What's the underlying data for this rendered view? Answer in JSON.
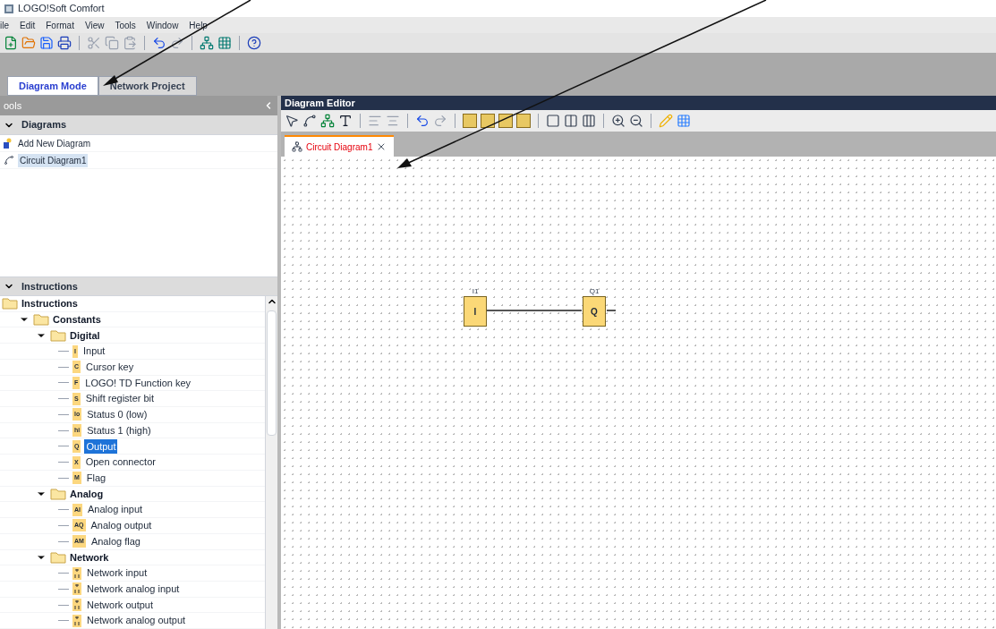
{
  "window": {
    "title": "LOGO!Soft Comfort"
  },
  "menu": [
    "ile",
    "Edit",
    "Format",
    "View",
    "Tools",
    "Window",
    "Help"
  ],
  "mode_tabs": [
    {
      "label": "Diagram Mode",
      "selected": true
    },
    {
      "label": "Network Project",
      "selected": false
    }
  ],
  "tools_panel": {
    "title": "ools",
    "diagrams": {
      "title": "Diagrams",
      "expanded": true,
      "items": [
        {
          "label": "Add New Diagram",
          "kind": "add",
          "selected": false
        },
        {
          "label": "Circuit Diagram1",
          "kind": "diagram",
          "selected": true
        }
      ]
    },
    "instructions": {
      "title": "Instructions",
      "expanded": true,
      "tree": [
        {
          "label": "Instructions",
          "kind": "folder",
          "expanded": true,
          "children": [
            {
              "label": "Constants",
              "kind": "folder",
              "expanded": true,
              "children": [
                {
                  "label": "Digital",
                  "kind": "folder",
                  "expanded": true,
                  "children": [
                    {
                      "label": "Input",
                      "kind": "leaf",
                      "badge": "I",
                      "selected": false
                    },
                    {
                      "label": "Cursor key",
                      "kind": "leaf",
                      "badge": "C",
                      "selected": false
                    },
                    {
                      "label": "LOGO! TD Function key",
                      "kind": "leaf",
                      "badge": "F",
                      "selected": false
                    },
                    {
                      "label": "Shift register bit",
                      "kind": "leaf",
                      "badge": "S",
                      "selected": false
                    },
                    {
                      "label": "Status 0 (low)",
                      "kind": "leaf",
                      "badge": "lo",
                      "selected": false
                    },
                    {
                      "label": "Status 1 (high)",
                      "kind": "leaf",
                      "badge": "hi",
                      "selected": false
                    },
                    {
                      "label": "Output",
                      "kind": "leaf",
                      "badge": "Q",
                      "selected": true
                    },
                    {
                      "label": "Open connector",
                      "kind": "leaf",
                      "badge": "X",
                      "selected": false
                    },
                    {
                      "label": "Flag",
                      "kind": "leaf",
                      "badge": "M",
                      "selected": false
                    }
                  ]
                },
                {
                  "label": "Analog",
                  "kind": "folder",
                  "expanded": true,
                  "children": [
                    {
                      "label": "Analog input",
                      "kind": "leaf",
                      "badge": "AI",
                      "selected": false
                    },
                    {
                      "label": "Analog output",
                      "kind": "leaf",
                      "badge": "AQ",
                      "selected": false
                    },
                    {
                      "label": "Analog flag",
                      "kind": "leaf",
                      "badge": "AM",
                      "selected": false
                    }
                  ]
                },
                {
                  "label": "Network",
                  "kind": "folder",
                  "expanded": true,
                  "children": [
                    {
                      "label": "Network input",
                      "kind": "network",
                      "selected": false
                    },
                    {
                      "label": "Network analog input",
                      "kind": "network",
                      "selected": false
                    },
                    {
                      "label": "Network output",
                      "kind": "network",
                      "selected": false
                    },
                    {
                      "label": "Network analog output",
                      "kind": "network",
                      "selected": false
                    }
                  ]
                }
              ]
            }
          ]
        }
      ]
    }
  },
  "editor": {
    "title": "Diagram Editor",
    "tabs": [
      {
        "label": "Circuit Diagram1",
        "selected": true
      }
    ],
    "blocks": [
      {
        "name": "I1",
        "symbol": "I",
        "kind": "input"
      },
      {
        "name": "Q1",
        "symbol": "Q",
        "kind": "output"
      }
    ]
  }
}
